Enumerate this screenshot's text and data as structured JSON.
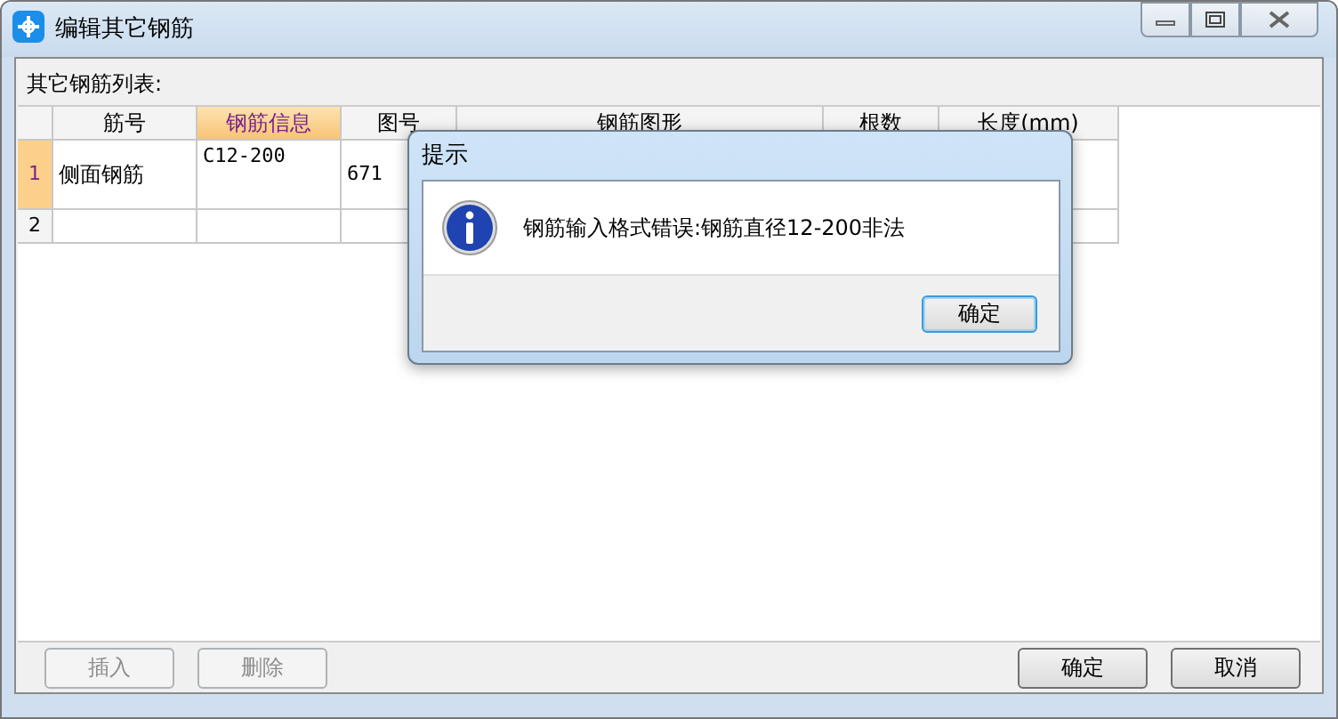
{
  "window": {
    "title": "编辑其它钢筋"
  },
  "list_label": "其它钢筋列表:",
  "table": {
    "columns": [
      {
        "label": "筋号",
        "selected": false
      },
      {
        "label": "钢筋信息",
        "selected": true
      },
      {
        "label": "图号",
        "selected": false
      },
      {
        "label": "钢筋图形",
        "selected": false
      },
      {
        "label": "根数",
        "selected": false
      },
      {
        "label": "长度(mm)",
        "selected": false
      }
    ],
    "rows": [
      {
        "number": "1",
        "selected": true,
        "cells": [
          "侧面钢筋",
          "C12-200",
          "671",
          "",
          "",
          ""
        ]
      },
      {
        "number": "2",
        "selected": false,
        "cells": [
          "",
          "",
          "",
          "",
          "",
          ""
        ]
      }
    ]
  },
  "buttons_left": [
    {
      "label": "插入",
      "disabled": true
    },
    {
      "label": "删除",
      "disabled": true
    }
  ],
  "buttons_right": [
    {
      "label": "确定",
      "disabled": false
    },
    {
      "label": "取消",
      "disabled": false
    }
  ],
  "dialog": {
    "title": "提示",
    "message": "钢筋输入格式错误:钢筋直径12-200非法",
    "button": "确定"
  }
}
